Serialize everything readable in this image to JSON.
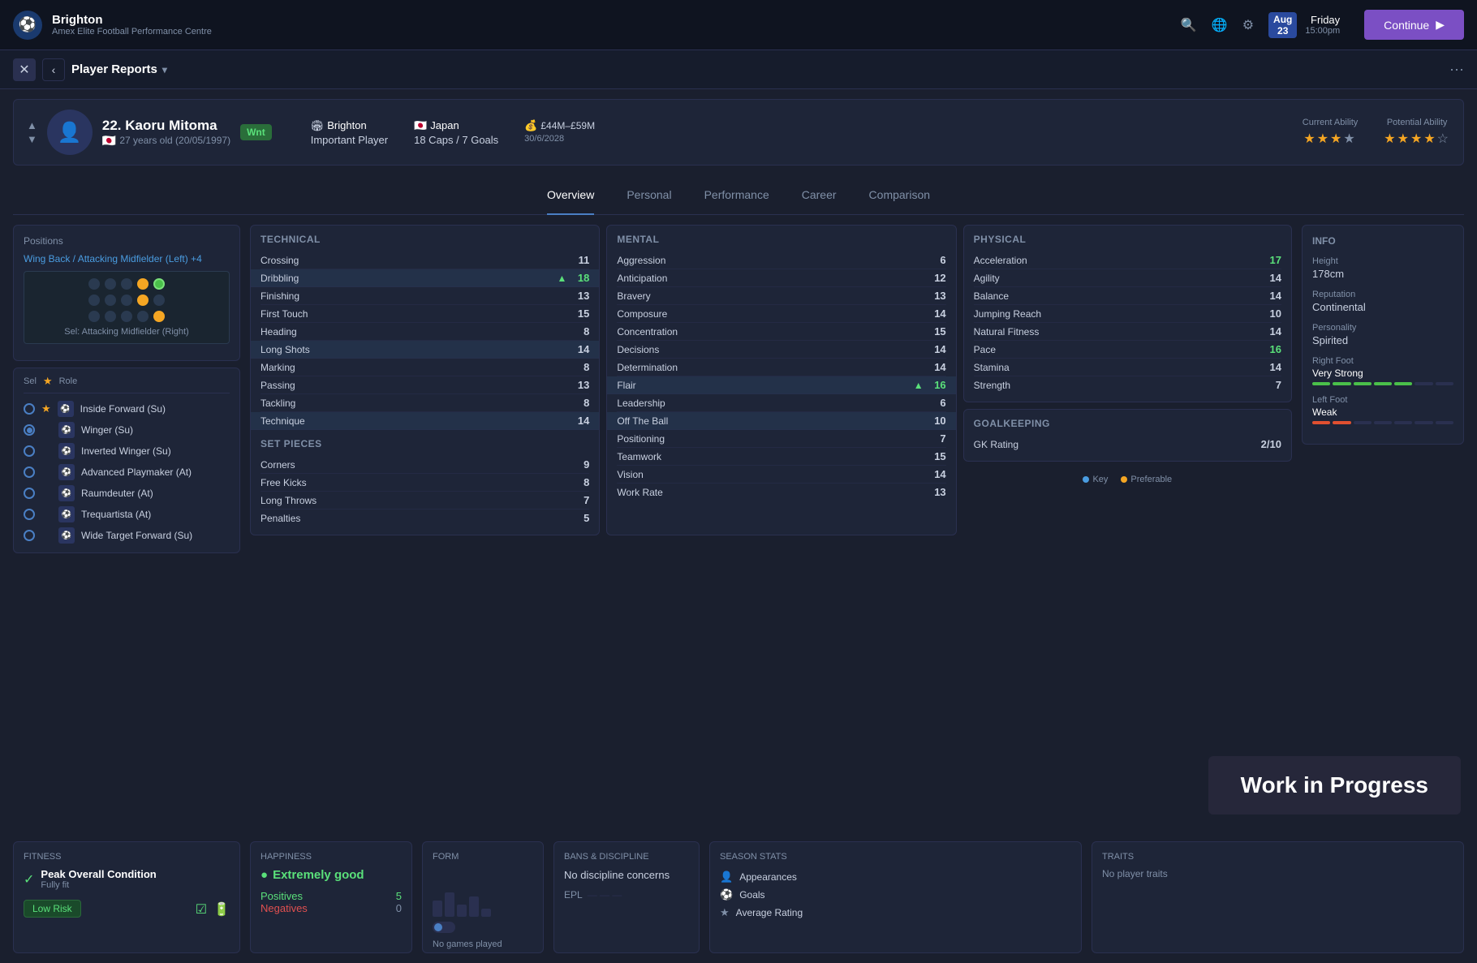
{
  "topNav": {
    "clubName": "Brighton",
    "clubSub": "Amex Elite Football Performance Centre",
    "date": "Friday",
    "time": "15:00pm",
    "dateDay": "23",
    "dateMonth": "Aug",
    "continueBtn": "Continue"
  },
  "breadcrumb": {
    "title": "Player Reports",
    "moreIcon": "···"
  },
  "player": {
    "number": "22.",
    "name": "Kaoru Mitoma",
    "age": "27 years old (20/05/1997)",
    "badge": "Wnt",
    "club": "Brighton",
    "clubRole": "Important Player",
    "country": "Japan",
    "caps": "18 Caps / 7 Goals",
    "contract": "£44M–£59M",
    "contractEnd": "30/6/2028",
    "currentAbility": "Current Ability",
    "potentialAbility": "Potential Ability"
  },
  "tabs": {
    "items": [
      "Overview",
      "Personal",
      "Performance",
      "Career",
      "Comparison"
    ],
    "active": "Overview"
  },
  "positions": {
    "label": "Positions",
    "value": "Wing Back / Attacking Midfielder (Left) +4",
    "sel": "Sel: Attacking Midfielder (Right)"
  },
  "roles": {
    "selLabel": "Sel",
    "roleLabel": "Role",
    "items": [
      {
        "name": "Inside Forward (Su)",
        "star": true,
        "selected": false
      },
      {
        "name": "Winger (Su)",
        "star": false,
        "selected": true
      },
      {
        "name": "Inverted Winger (Su)",
        "star": false,
        "selected": false
      },
      {
        "name": "Advanced Playmaker (At)",
        "star": false,
        "selected": false
      },
      {
        "name": "Raumdeuter (At)",
        "star": false,
        "selected": false
      },
      {
        "name": "Trequartista (At)",
        "star": false,
        "selected": false
      },
      {
        "name": "Wide Target Forward (Su)",
        "star": false,
        "selected": false
      }
    ]
  },
  "technical": {
    "title": "Technical",
    "stats": [
      {
        "name": "Crossing",
        "value": 11,
        "highlight": false,
        "arrow": false
      },
      {
        "name": "Dribbling",
        "value": 18,
        "highlight": true,
        "arrow": true
      },
      {
        "name": "Finishing",
        "value": 13,
        "highlight": false,
        "arrow": false
      },
      {
        "name": "First Touch",
        "value": 15,
        "highlight": false,
        "arrow": false
      },
      {
        "name": "Heading",
        "value": 8,
        "highlight": false,
        "arrow": false
      },
      {
        "name": "Long Shots",
        "value": 14,
        "highlight": true,
        "arrow": false
      },
      {
        "name": "Marking",
        "value": 8,
        "highlight": false,
        "arrow": false
      },
      {
        "name": "Passing",
        "value": 13,
        "highlight": false,
        "arrow": false
      },
      {
        "name": "Tackling",
        "value": 8,
        "highlight": false,
        "arrow": false
      },
      {
        "name": "Technique",
        "value": 14,
        "highlight": true,
        "arrow": false
      }
    ]
  },
  "setPieces": {
    "title": "Set Pieces",
    "stats": [
      {
        "name": "Corners",
        "value": 9
      },
      {
        "name": "Free Kicks",
        "value": 8
      },
      {
        "name": "Long Throws",
        "value": 7
      },
      {
        "name": "Penalties",
        "value": 5
      }
    ]
  },
  "mental": {
    "title": "Mental",
    "stats": [
      {
        "name": "Aggression",
        "value": 6,
        "highlight": false,
        "arrow": false
      },
      {
        "name": "Anticipation",
        "value": 12,
        "highlight": false,
        "arrow": false
      },
      {
        "name": "Bravery",
        "value": 13,
        "highlight": false,
        "arrow": false
      },
      {
        "name": "Composure",
        "value": 14,
        "highlight": false,
        "arrow": false
      },
      {
        "name": "Concentration",
        "value": 15,
        "highlight": false,
        "arrow": false
      },
      {
        "name": "Decisions",
        "value": 14,
        "highlight": false,
        "arrow": false
      },
      {
        "name": "Determination",
        "value": 14,
        "highlight": false,
        "arrow": false
      },
      {
        "name": "Flair",
        "value": 16,
        "highlight": true,
        "arrow": true
      },
      {
        "name": "Leadership",
        "value": 6,
        "highlight": false,
        "arrow": false
      },
      {
        "name": "Off The Ball",
        "value": 10,
        "highlight": true,
        "arrow": false
      },
      {
        "name": "Positioning",
        "value": 7,
        "highlight": false,
        "arrow": false
      },
      {
        "name": "Teamwork",
        "value": 15,
        "highlight": false,
        "arrow": false
      },
      {
        "name": "Vision",
        "value": 14,
        "highlight": false,
        "arrow": false
      },
      {
        "name": "Work Rate",
        "value": 13,
        "highlight": false,
        "arrow": false
      }
    ]
  },
  "physical": {
    "title": "Physical",
    "stats": [
      {
        "name": "Acceleration",
        "value": 17
      },
      {
        "name": "Agility",
        "value": 14
      },
      {
        "name": "Balance",
        "value": 14
      },
      {
        "name": "Jumping Reach",
        "value": 10
      },
      {
        "name": "Natural Fitness",
        "value": 14
      },
      {
        "name": "Pace",
        "value": 16
      },
      {
        "name": "Stamina",
        "value": 14
      },
      {
        "name": "Strength",
        "value": 7
      }
    ]
  },
  "goalkeeping": {
    "title": "Goalkeeping",
    "stats": [
      {
        "name": "GK Rating",
        "value": "2/10"
      }
    ]
  },
  "info": {
    "title": "Info",
    "height": {
      "label": "Height",
      "value": "178cm"
    },
    "reputation": {
      "label": "Reputation",
      "value": "Continental"
    },
    "personality": {
      "label": "Personality",
      "value": "Spirited"
    },
    "rightFoot": {
      "label": "Right Foot",
      "value": "Very Strong"
    },
    "leftFoot": {
      "label": "Left Foot",
      "value": "Weak"
    }
  },
  "legend": {
    "key": "Key",
    "preferable": "Preferable"
  },
  "fitness": {
    "title": "Fitness",
    "condition": "Peak Overall Condition",
    "conditionSub": "Fully fit",
    "risk": "Low Risk"
  },
  "happiness": {
    "title": "Happiness",
    "value": "Extremely good",
    "positives": "Positives",
    "positivesCount": 5,
    "negatives": "Negatives",
    "negativesCount": 0
  },
  "form": {
    "title": "Form",
    "noGames": "No games played"
  },
  "discipline": {
    "title": "Bans & Discipline",
    "text": "No discipline concerns",
    "league": "EPL"
  },
  "seasonStats": {
    "title": "Season Stats",
    "stats": [
      {
        "name": "Appearances",
        "icon": "👤"
      },
      {
        "name": "Goals",
        "icon": "⚽"
      },
      {
        "name": "Average Rating",
        "icon": "★"
      }
    ]
  },
  "traits": {
    "title": "Traits",
    "empty": "No player traits"
  },
  "wip": "Work in Progress"
}
